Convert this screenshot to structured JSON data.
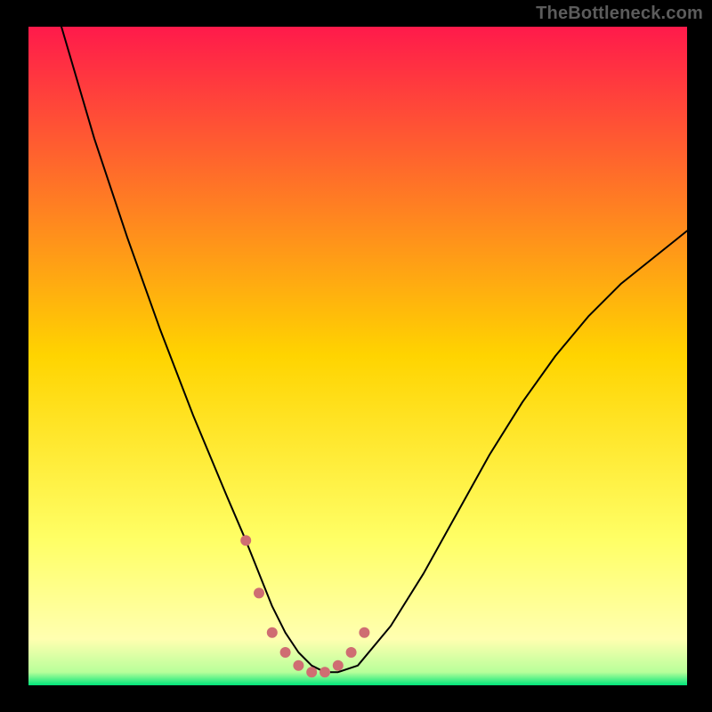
{
  "watermark": "TheBottleneck.com",
  "chart_data": {
    "type": "line",
    "title": "",
    "xlabel": "",
    "ylabel": "",
    "xlim": [
      0,
      100
    ],
    "ylim": [
      0,
      100
    ],
    "grid": false,
    "legend": null,
    "background_gradient": {
      "stops": [
        {
          "offset": 0.0,
          "color": "#ff1a4b"
        },
        {
          "offset": 0.5,
          "color": "#ffd400"
        },
        {
          "offset": 0.78,
          "color": "#ffff66"
        },
        {
          "offset": 0.93,
          "color": "#ffffb0"
        },
        {
          "offset": 0.98,
          "color": "#b8ff9a"
        },
        {
          "offset": 1.0,
          "color": "#00e57a"
        }
      ]
    },
    "series": [
      {
        "name": "curve",
        "color": "#000000",
        "stroke_width": 2,
        "x": [
          5,
          10,
          15,
          20,
          25,
          30,
          33,
          35,
          37,
          39,
          41,
          43,
          45,
          47,
          50,
          55,
          60,
          65,
          70,
          75,
          80,
          85,
          90,
          95,
          100
        ],
        "y": [
          100,
          83,
          68,
          54,
          41,
          29,
          22,
          17,
          12,
          8,
          5,
          3,
          2,
          2,
          3,
          9,
          17,
          26,
          35,
          43,
          50,
          56,
          61,
          65,
          69
        ]
      },
      {
        "name": "markers",
        "color": "#cf6d72",
        "marker_size": 6,
        "x": [
          33,
          35,
          37,
          39,
          41,
          43,
          45,
          47,
          49,
          51
        ],
        "y": [
          22,
          14,
          8,
          5,
          3,
          2,
          2,
          3,
          5,
          8
        ]
      }
    ]
  }
}
